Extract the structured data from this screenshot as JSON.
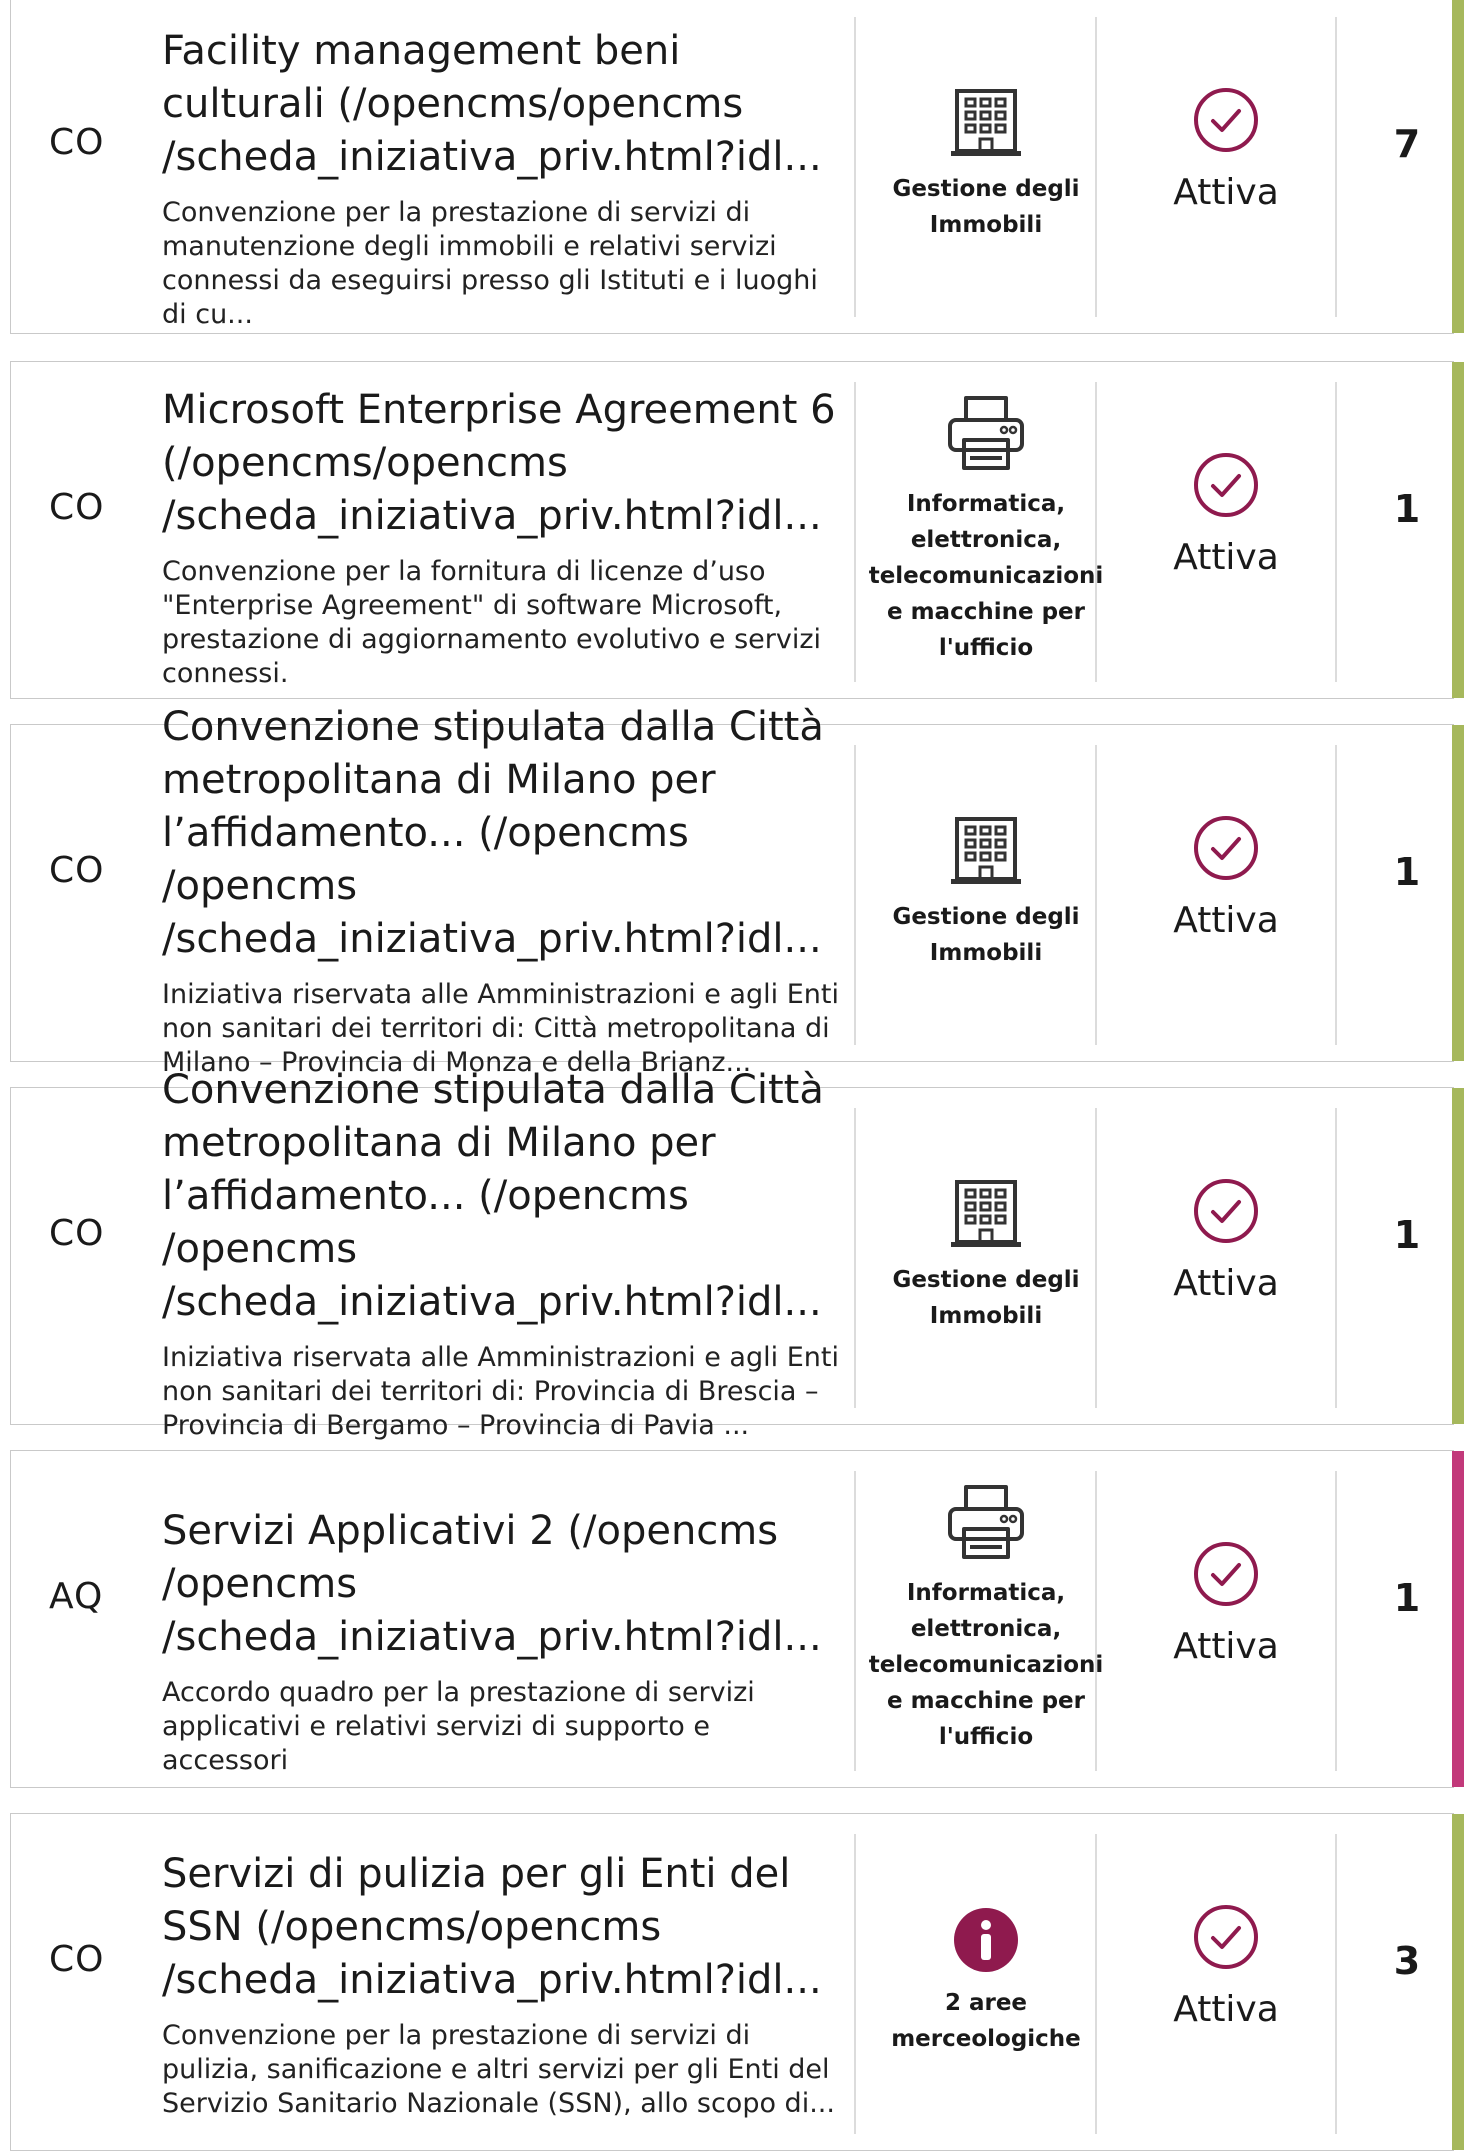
{
  "colors": {
    "green_accent": "#a6b85c",
    "magenta_accent": "#c2397a",
    "state_icon": "#8f1a4e",
    "info_icon": "#8f1a4e"
  },
  "rows": [
    {
      "type": "CO",
      "title": "Facility management beni culturali (/opencms/opencms /scheda_iniziativa_priv.html?idl...",
      "description": "Convenzione per la prestazione di servizi di manutenzione degli immobili e relativi servizi connessi da eseguirsi presso gli Istituti e i luoghi di cu...",
      "category_icon": "building-icon",
      "category": "Gestione degli Immobili",
      "state": "Attiva",
      "count": "7",
      "accent": "green"
    },
    {
      "type": "CO",
      "title": "Microsoft Enterprise Agreement 6 (/opencms/opencms /scheda_iniziativa_priv.html?idl...",
      "description": "Convenzione per la fornitura di licenze d’uso \"Enterprise Agreement\" di software Microsoft, prestazione di aggiornamento evolutivo e servizi connessi.",
      "category_icon": "printer-icon",
      "category": "Informatica, elettronica, telecomunicazioni e macchine per l'ufficio",
      "state": "Attiva",
      "count": "1",
      "accent": "green"
    },
    {
      "type": "CO",
      "title": "Convenzione stipulata dalla Città metropolitana di Milano per l’affidamento... (/opencms /opencms /scheda_iniziativa_priv.html?idl...",
      "description": "Iniziativa riservata alle Amministrazioni e agli Enti non sanitari dei territori di: Città metropolitana di Milano – Provincia di Monza e della Brianz...",
      "category_icon": "building-icon",
      "category": "Gestione degli Immobili",
      "state": "Attiva",
      "count": "1",
      "accent": "green"
    },
    {
      "type": "CO",
      "title": "Convenzione stipulata dalla Città metropolitana di Milano per l’affidamento... (/opencms /opencms /scheda_iniziativa_priv.html?idl...",
      "description": "Iniziativa riservata alle Amministrazioni e agli Enti non sanitari dei territori di: Provincia di Brescia – Provincia di Bergamo – Provincia di Pavia ...",
      "category_icon": "building-icon",
      "category": "Gestione degli Immobili",
      "state": "Attiva",
      "count": "1",
      "accent": "green"
    },
    {
      "type": "AQ",
      "title": "Servizi Applicativi 2 (/opencms /opencms /scheda_iniziativa_priv.html?idl...",
      "description": "Accordo quadro per la prestazione di servizi applicativi e relativi servizi di supporto e accessori",
      "category_icon": "printer-icon",
      "category": "Informatica, elettronica, telecomunicazioni e macchine per l'ufficio",
      "state": "Attiva",
      "count": "1",
      "accent": "magenta"
    },
    {
      "type": "CO",
      "title": "Servizi di pulizia per gli Enti del SSN (/opencms/opencms /scheda_iniziativa_priv.html?idl...",
      "description": "Convenzione per la prestazione di servizi di pulizia, sanificazione e altri servizi per gli Enti del Servizio Sanitario Nazionale (SSN), allo scopo di...",
      "category_icon": "info-icon",
      "category": "2 aree merceologiche",
      "state": "Attiva",
      "count": "3",
      "accent": "green"
    }
  ]
}
